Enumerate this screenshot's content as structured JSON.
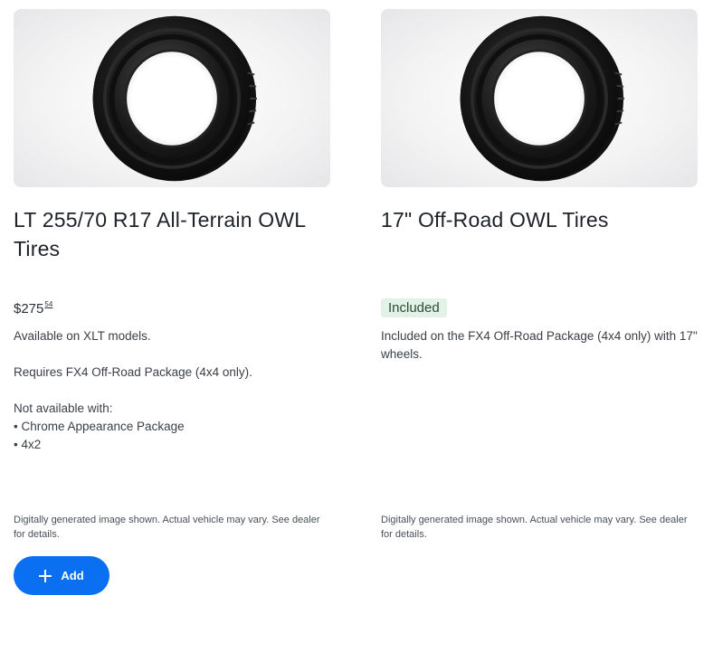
{
  "cards": [
    {
      "title": "LT 255/70 R17 All-Terrain OWL Tires",
      "price_dollars": "$275",
      "price_cents": "54",
      "description": {
        "line1": "Available on XLT models.",
        "line2": "Requires FX4 Off-Road Package (4x4 only).",
        "line3": "Not available with:",
        "bullets": [
          "• Chrome Appearance Package",
          "• 4x2"
        ]
      },
      "disclaimer": "Digitally generated image shown. Actual vehicle may vary. See dealer for details.",
      "add_label": "Add",
      "image_icon": "tire-image"
    },
    {
      "title": "17\" Off-Road OWL Tires",
      "badge": "Included",
      "description": {
        "line1": "Included on the FX4 Off-Road Package (4x4 only) with 17\" wheels."
      },
      "disclaimer": "Digitally generated image shown. Actual vehicle may vary. See dealer for details.",
      "image_icon": "tire-image"
    }
  ],
  "colors": {
    "accent": "#0a6ff0",
    "badge_bg": "#e3f2e6",
    "badge_text": "#2d4a34"
  }
}
